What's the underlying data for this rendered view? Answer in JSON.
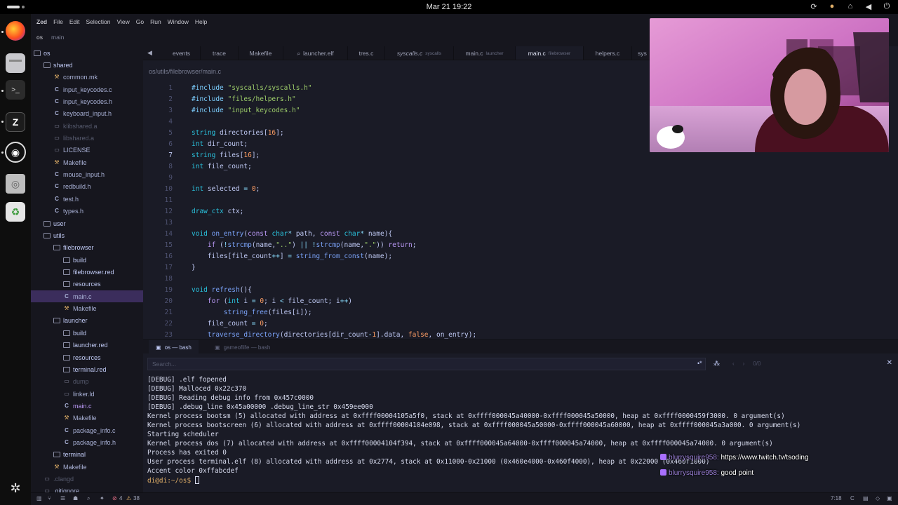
{
  "topbar": {
    "clock": "Mar 21  19:22"
  },
  "titlebar": {
    "menu": [
      "Zed",
      "File",
      "Edit",
      "Selection",
      "View",
      "Go",
      "Run",
      "Window",
      "Help"
    ],
    "project": "os",
    "branch": "main"
  },
  "sidebar": {
    "rows": [
      {
        "label": "os",
        "kind": "folder",
        "depth": 0
      },
      {
        "label": "shared",
        "kind": "folder",
        "depth": 1
      },
      {
        "label": "common.mk",
        "kind": "mk",
        "depth": 2
      },
      {
        "label": "input_keycodes.c",
        "kind": "c",
        "depth": 2
      },
      {
        "label": "input_keycodes.h",
        "kind": "c",
        "depth": 2
      },
      {
        "label": "keyboard_input.h",
        "kind": "c",
        "depth": 2
      },
      {
        "label": "klibshared.a",
        "kind": "file",
        "depth": 2,
        "dim": true
      },
      {
        "label": "libshared.a",
        "kind": "file",
        "depth": 2,
        "dim": true
      },
      {
        "label": "LICENSE",
        "kind": "file",
        "depth": 2
      },
      {
        "label": "Makefile",
        "kind": "mk",
        "depth": 2
      },
      {
        "label": "mouse_input.h",
        "kind": "c",
        "depth": 2
      },
      {
        "label": "redbuild.h",
        "kind": "c",
        "depth": 2
      },
      {
        "label": "test.h",
        "kind": "c",
        "depth": 2
      },
      {
        "label": "types.h",
        "kind": "c",
        "depth": 2
      },
      {
        "label": "user",
        "kind": "folder",
        "depth": 1
      },
      {
        "label": "utils",
        "kind": "folder",
        "depth": 1
      },
      {
        "label": "filebrowser",
        "kind": "folder",
        "depth": 2
      },
      {
        "label": "build",
        "kind": "folder",
        "depth": 3
      },
      {
        "label": "filebrowser.red",
        "kind": "folder",
        "depth": 3,
        "dim": true
      },
      {
        "label": "resources",
        "kind": "folder",
        "depth": 3
      },
      {
        "label": "main.c",
        "kind": "c",
        "depth": 3,
        "selected": true
      },
      {
        "label": "Makefile",
        "kind": "mk",
        "depth": 3
      },
      {
        "label": "launcher",
        "kind": "folder",
        "depth": 2
      },
      {
        "label": "build",
        "kind": "folder",
        "depth": 3
      },
      {
        "label": "launcher.red",
        "kind": "folder",
        "depth": 3,
        "dim": true
      },
      {
        "label": "resources",
        "kind": "folder",
        "depth": 3
      },
      {
        "label": "terminal.red",
        "kind": "folder",
        "depth": 3,
        "dim": true
      },
      {
        "label": "dump",
        "kind": "file",
        "depth": 3,
        "dim": true
      },
      {
        "label": "linker.ld",
        "kind": "file",
        "depth": 3
      },
      {
        "label": "main.c",
        "kind": "c",
        "depth": 3,
        "highlight": true
      },
      {
        "label": "Makefile",
        "kind": "mk",
        "depth": 3
      },
      {
        "label": "package_info.c",
        "kind": "c",
        "depth": 3
      },
      {
        "label": "package_info.h",
        "kind": "c",
        "depth": 3
      },
      {
        "label": "terminal",
        "kind": "folder",
        "depth": 2
      },
      {
        "label": "Makefile",
        "kind": "mk",
        "depth": 2
      },
      {
        "label": ".clangd",
        "kind": "file",
        "depth": 1,
        "dim": true
      },
      {
        "label": ".gitignore",
        "kind": "file",
        "depth": 1
      }
    ]
  },
  "tabs": [
    {
      "label": "events",
      "sub": ""
    },
    {
      "label": "trace",
      "sub": ""
    },
    {
      "label": "Makefile",
      "sub": ""
    },
    {
      "label": "launcher.elf",
      "sub": ""
    },
    {
      "label": "tres.c",
      "sub": ""
    },
    {
      "label": "syscalls.c",
      "sub": "syscalls",
      "italic": true
    },
    {
      "label": "main.c",
      "sub": "launcher"
    },
    {
      "label": "main.c",
      "sub": "filebrowser",
      "active": true
    },
    {
      "label": "helpers.c",
      "sub": ""
    },
    {
      "label": "sys",
      "sub": ""
    }
  ],
  "breadcrumb": "os/utils/filebrowser/main.c",
  "editor": {
    "current_line": 7,
    "lines": [
      {
        "n": "1",
        "html": "<span class='pr'>#include</span> <span class='str'>\"syscalls/syscalls.h\"</span>"
      },
      {
        "n": "2",
        "html": "<span class='pr'>#include</span> <span class='str'>\"files/helpers.h\"</span>"
      },
      {
        "n": "3",
        "html": "<span class='pr'>#include</span> <span class='str'>\"input_keycodes.h\"</span>"
      },
      {
        "n": "4",
        "html": ""
      },
      {
        "n": "5",
        "html": "<span class='ty'>string</span> directories[<span class='num'>16</span>];"
      },
      {
        "n": "6",
        "html": "<span class='ty'>int</span> dir_count;"
      },
      {
        "n": "7",
        "html": "<span class='ty'>string</span> files[<span class='num'>16</span>];"
      },
      {
        "n": "8",
        "html": "<span class='ty'>int</span> file_count;"
      },
      {
        "n": "9",
        "html": ""
      },
      {
        "n": "10",
        "html": "<span class='ty'>int</span> selected <span class='op'>=</span> <span class='num'>0</span>;"
      },
      {
        "n": "11",
        "html": ""
      },
      {
        "n": "12",
        "html": "<span class='ty'>draw_ctx</span> ctx;"
      },
      {
        "n": "13",
        "html": ""
      },
      {
        "n": "14",
        "html": "<span class='ty'>void</span> <span class='fn'>on_entry</span>(<span class='kw'>const</span> <span class='ty'>char</span><span class='op'>*</span> path, <span class='kw'>const</span> <span class='ty'>char</span><span class='op'>*</span> name){"
      },
      {
        "n": "15",
        "html": "    <span class='kw'>if</span> (<span class='op'>!</span><span class='fn'>strcmp</span>(name,<span class='str'>\"..\"</span>) <span class='op'>||</span> <span class='op'>!</span><span class='fn'>strcmp</span>(name,<span class='str'>\".\"</span>)) <span class='kw'>return</span>;"
      },
      {
        "n": "16",
        "html": "    files[file_count<span class='op'>++</span>] <span class='op'>=</span> <span class='fn'>string_from_const</span>(name);"
      },
      {
        "n": "17",
        "html": "}"
      },
      {
        "n": "18",
        "html": ""
      },
      {
        "n": "19",
        "html": "<span class='ty'>void</span> <span class='fn'>refresh</span>(){"
      },
      {
        "n": "20",
        "html": "    <span class='kw'>for</span> (<span class='ty'>int</span> i <span class='op'>=</span> <span class='num'>0</span>; i <span class='op'>&lt;</span> file_count; i<span class='op'>++</span>)"
      },
      {
        "n": "21",
        "html": "        <span class='fn'>string_free</span>(files[i]);"
      },
      {
        "n": "22",
        "html": "    file_count <span class='op'>=</span> <span class='num'>0</span>;"
      },
      {
        "n": "23",
        "html": "    <span class='fn'>traverse_directory</span>(directories[dir_count<span class='op'>-</span><span class='num'>1</span>].data, <span class='bo'>false</span>, on_entry);"
      }
    ]
  },
  "terminal": {
    "tabs": [
      {
        "label": "os — bash",
        "active": true
      },
      {
        "label": "gameoflife — bash",
        "active": false
      }
    ],
    "search_placeholder": "Search...",
    "match_count": "0/0",
    "lines": [
      "[DEBUG] .elf fopened",
      "[DEBUG] Malloced 0x22c370",
      "[DEBUG] Reading debug info from 0x457c0000",
      "[DEBUG] .debug_line 0x45a00000 .debug_line_str 0x459ee000",
      "Kernel process bootsm (5) allocated with address at 0xffff00004105a5f0, stack at 0xffff000045a40000-0xffff000045a50000, heap at 0xffff0000459f3000. 0 argument(s)",
      "Kernel process bootscreen (6) allocated with address at 0xffff00004104e098, stack at 0xffff000045a50000-0xffff000045a60000, heap at 0xffff000045a3a000. 0 argument(s)",
      "Starting scheduler",
      "Kernel process dos (7) allocated with address at 0xffff00004104f394, stack at 0xffff000045a64000-0xffff000045a74000, heap at 0xffff000045a74000. 0 argument(s)",
      "Process has exited 0",
      "User process terminal.elf (8) allocated with address at 0x2774, stack at 0x11000-0x21000 (0x460e4000-0x460f4000), heap at 0x22000 (0x460f1000)",
      "Accent color 0xffabcdef"
    ],
    "prompt": "di@di:~/os$ "
  },
  "statusbar": {
    "errors": "4",
    "warnings": "38",
    "position": "7:18",
    "language": "C"
  },
  "chat": [
    {
      "user": "blurrysquire958:",
      "text": "https://www.twitch.tv/tsoding"
    },
    {
      "user": "blurrysquire958:",
      "text": "good point"
    }
  ]
}
